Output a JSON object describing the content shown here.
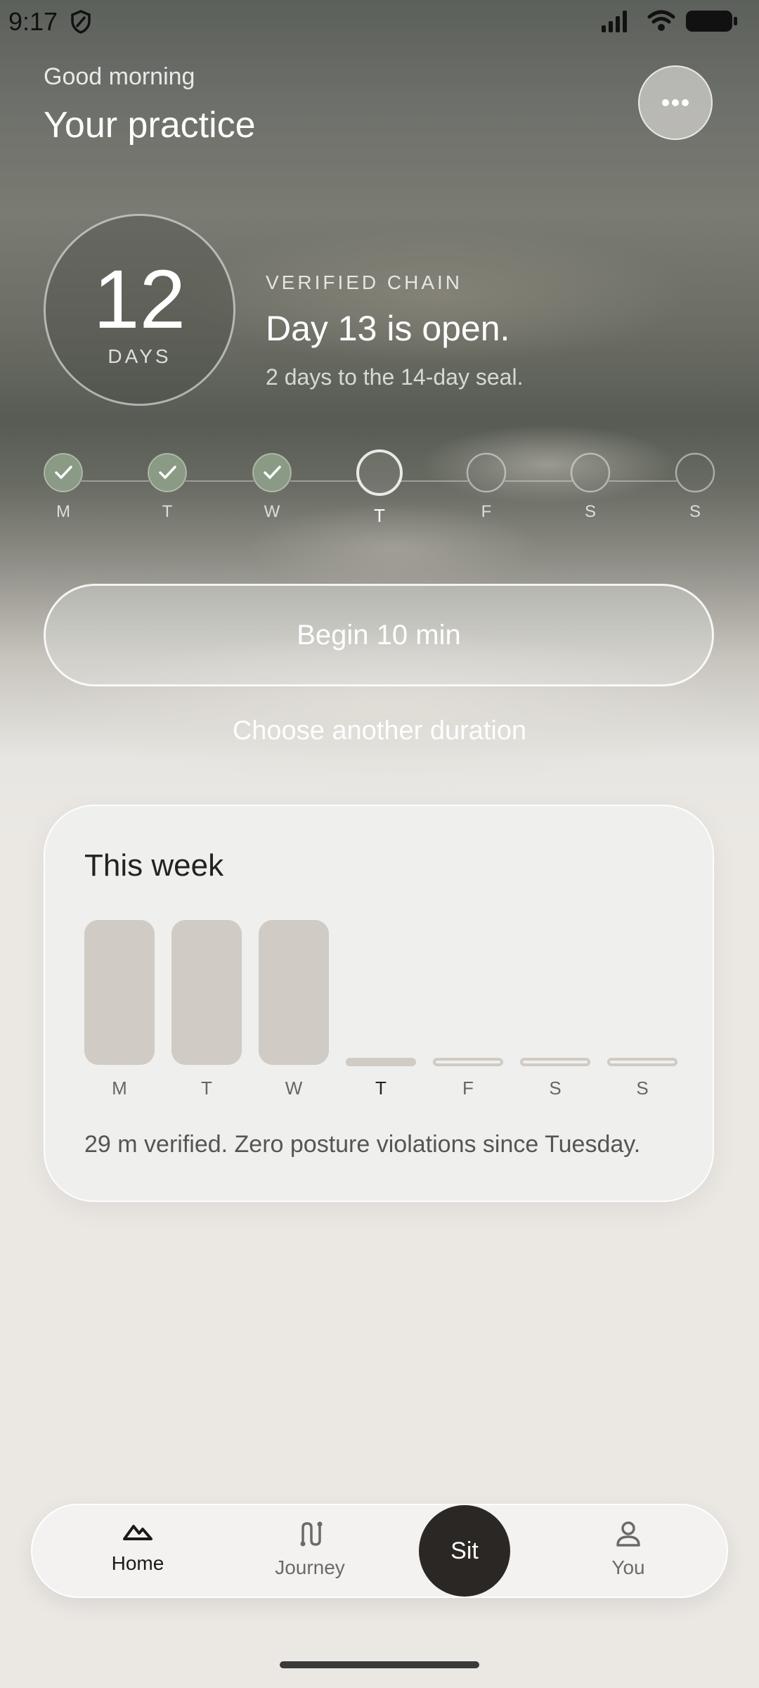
{
  "status_bar": {
    "time": "9:17",
    "icons": [
      "shield-icon",
      "signal-icon",
      "wifi-icon",
      "battery-icon"
    ]
  },
  "header": {
    "greeting": "Good morning",
    "title": "Your practice",
    "more_icon": "more-dots-icon"
  },
  "streak": {
    "count": "12",
    "unit": "DAYS"
  },
  "chain": {
    "label": "VERIFIED CHAIN",
    "headline": "Day 13 is open.",
    "subtext": "2 days to the 14-day seal."
  },
  "week_progress": {
    "days": [
      {
        "letter": "M",
        "state": "done"
      },
      {
        "letter": "T",
        "state": "done"
      },
      {
        "letter": "W",
        "state": "done"
      },
      {
        "letter": "T",
        "state": "today"
      },
      {
        "letter": "F",
        "state": "upcoming"
      },
      {
        "letter": "S",
        "state": "upcoming"
      },
      {
        "letter": "S",
        "state": "upcoming"
      }
    ]
  },
  "actions": {
    "begin_label": "Begin 10 min",
    "choose_label": "Choose another duration"
  },
  "week_card": {
    "title": "This week",
    "bars": [
      {
        "letter": "M",
        "level": 1.0,
        "state": "done"
      },
      {
        "letter": "T",
        "level": 1.0,
        "state": "done"
      },
      {
        "letter": "W",
        "level": 1.0,
        "state": "done"
      },
      {
        "letter": "T",
        "level": 0,
        "state": "today"
      },
      {
        "letter": "F",
        "level": 0,
        "state": "upcoming"
      },
      {
        "letter": "S",
        "level": 0,
        "state": "upcoming"
      },
      {
        "letter": "S",
        "level": 0,
        "state": "upcoming"
      }
    ],
    "summary": "29 m verified. Zero posture violations since Tuesday."
  },
  "nav": {
    "home": "Home",
    "journey": "Journey",
    "sit": "Sit",
    "you": "You"
  },
  "colors": {
    "accent_green": "#8a9a84",
    "bar": "#d0cbc4",
    "dark": "#2b2725"
  }
}
